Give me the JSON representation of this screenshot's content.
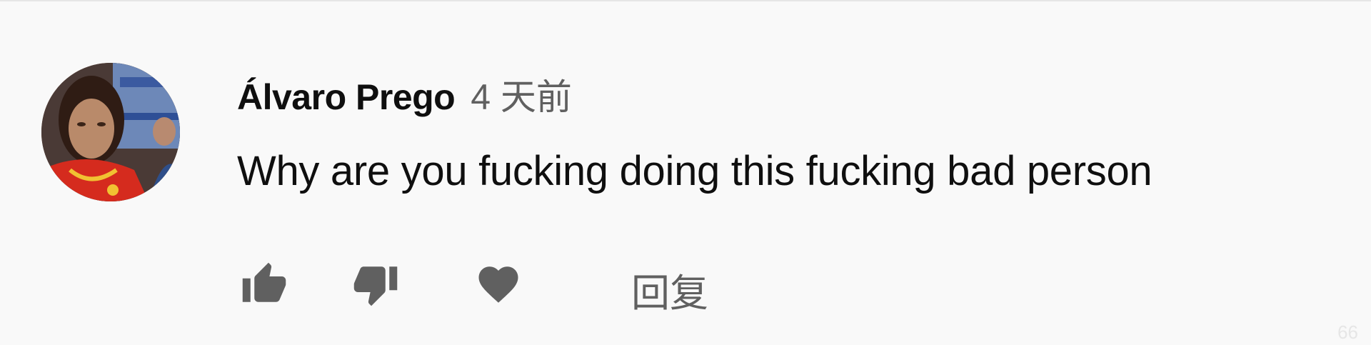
{
  "comment": {
    "author": "Álvaro Prego",
    "time": "4 天前",
    "text": "Why are you fucking doing this fucking bad person",
    "actions": {
      "like_icon": "thumbs-up-icon",
      "dislike_icon": "thumbs-down-icon",
      "heart_icon": "heart-icon",
      "reply_label": "回复"
    }
  },
  "watermark": "66",
  "colors": {
    "background": "#f9f9f9",
    "author": "#0f0f0f",
    "secondary": "#606060"
  }
}
